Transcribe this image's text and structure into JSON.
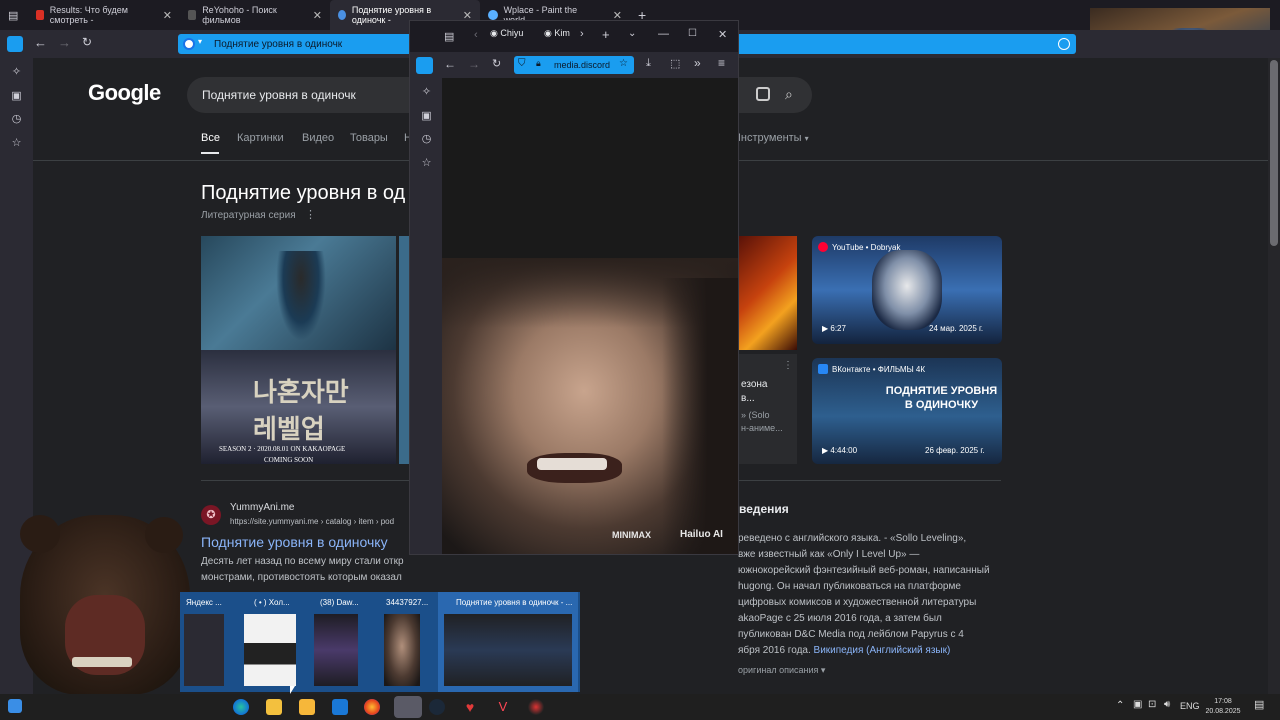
{
  "tabs": [
    {
      "title": "Results: Что будем смотреть - ",
      "icon": "youtube-icon",
      "color": "#d93025",
      "active": false
    },
    {
      "title": "ReYohoho - Поиск фильмов",
      "icon": "reyohoho-icon",
      "color": "#444",
      "active": false
    },
    {
      "title": "Поднятие уровня в одиночк - ",
      "icon": "google-icon",
      "color": "#4a90e2",
      "active": true
    },
    {
      "title": "Wplace - Paint the world",
      "icon": "wplace-icon",
      "color": "#5ab0ff",
      "active": false
    }
  ],
  "urlbar": {
    "text": "Поднятие уровня в одиночк"
  },
  "google": {
    "logo": "Google",
    "search_value": "Поднятие уровня в одиночк",
    "nav": [
      "Все",
      "Картинки",
      "Видео",
      "Товары",
      "Н"
    ],
    "tools": "Инструменты",
    "panel_title": "Поднятие уровня в од",
    "panel_subtitle": "Литературная серия",
    "poster_text1": "SEASON 2 · 2020.08.01 ON KAKAOPAGE",
    "poster_text2": "COMING SOON",
    "partial_card_lines": [
      "езона",
      "в...",
      "» (Solo",
      "н-аниме..."
    ],
    "video1": {
      "source": "YouTube • Dobryak",
      "duration": "6:27",
      "date": "24 мар. 2025 г."
    },
    "video2": {
      "source": "ВКонтакте • ФИЛЬМЫ 4К",
      "duration": "4:44:00",
      "date": "26 февр. 2025 г.",
      "overlay": "ПОДНЯТИЕ УРОВНЯ В ОДИНОЧКУ"
    },
    "result": {
      "site": "YummyAni.me",
      "url": "https://site.yummyani.me › catalog › item › pod",
      "title": "Поднятие уровня в одиночку",
      "snippet1": "Десять лет назад по всему миру стали откр",
      "snippet2": "монстрами, противостоять которым оказал"
    },
    "about_heading": "ведения",
    "about_lines": [
      "реведено с английского языка. - «Sollo Leveling»,",
      "вже известный как «Only I Level Up» —",
      "южнокорейский фэнтезийный веб-роман, написанный",
      "hugong. Он начал публиковаться на платформе",
      "цифровых комиксов и художественной литературы",
      "akaoPage с 25 июля 2016 года, а затем был",
      "публикован D&C Media под лейблом Papyrus с 4",
      "ября 2016 года."
    ],
    "about_link": "Википедия (Английский язык)",
    "about_more": "оригинал описания"
  },
  "popup": {
    "tab1": "Chiyu",
    "tab2": "Kim",
    "url": "media.discord",
    "watermark1": "MINIMAX",
    "watermark2": "Hailuo AI"
  },
  "thumbnails": [
    {
      "label": "Яндекс ..."
    },
    {
      "label": "( • ) Хол..."
    },
    {
      "label": "(38) Daw..."
    },
    {
      "label": "34437927..."
    },
    {
      "label": "Поднятие уровня в одиночк - ..."
    }
  ],
  "tray": {
    "lang": "ENG",
    "time": "17:08",
    "date": "20.08.2025"
  }
}
